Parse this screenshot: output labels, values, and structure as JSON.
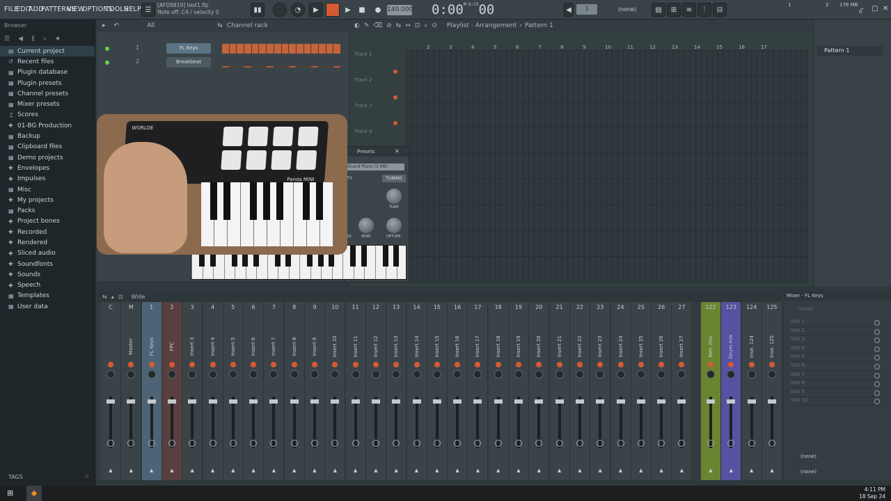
{
  "menu": [
    "FILE",
    "EDIT",
    "ADD",
    "PATTERNS",
    "VIEW",
    "OPTIONS",
    "TOOLS",
    "HELP"
  ],
  "hint": {
    "line1": "[AFD9819] test1.flp",
    "line2": "Note off: C4 / velocity 0"
  },
  "transport": {
    "bpm": "140.000",
    "time": "0:00",
    "time_sub": "00",
    "time_unit": "M:S:CS",
    "pattern_number": "1",
    "pattern_none": "(none)"
  },
  "cpu": {
    "value1": "1",
    "value2": "2",
    "mem": "178 MB",
    "poly": "0"
  },
  "browser": {
    "title": "Browser",
    "filter": "All",
    "items": [
      "Current project",
      "Recent files",
      "Plugin database",
      "Plugin presets",
      "Channel presets",
      "Mixer presets",
      "Scores",
      "01-BG Production",
      "Backup",
      "Clipboard files",
      "Demo projects",
      "Envelopes",
      "Impulses",
      "Misc",
      "My projects",
      "Packs",
      "Project bones",
      "Recorded",
      "Rendered",
      "Sliced audio",
      "Soundfonts",
      "Sounds",
      "Speech",
      "Templates",
      "User data"
    ],
    "tags_label": "TAGS"
  },
  "channel_rack": {
    "title": "Channel rack",
    "filter": "All",
    "channels": [
      {
        "num": "1",
        "name": "FL Keys"
      },
      {
        "num": "2",
        "name": "Breakbeat"
      }
    ]
  },
  "playlist": {
    "title": "Playlist - Arrangement",
    "pattern": "Pattern 1",
    "ruler": [
      "2",
      "3",
      "4",
      "5",
      "6",
      "7",
      "8",
      "9",
      "10",
      "11",
      "12",
      "13",
      "14",
      "15",
      "16",
      "17"
    ],
    "tracks": [
      "Track 1",
      "Track 2",
      "Track 3",
      "Track 4"
    ]
  },
  "pattern_panel": {
    "item": "Pattern 1"
  },
  "plugin": {
    "title": "Presets",
    "preset": "Grand Piano (3 MB)",
    "tab1": "TY",
    "tab2": "TUNING",
    "knob_labels": [
      "TUNE",
      "SENS",
      "DETUNE",
      "ESS"
    ]
  },
  "video": {
    "brand": "WORLDE",
    "model": "Panda MINI"
  },
  "mixer": {
    "title": "Mixer - FL Keys",
    "mode": "Wide",
    "tracks": [
      {
        "num": "C",
        "label": ""
      },
      {
        "num": "M",
        "label": "Master"
      },
      {
        "num": "1",
        "label": "FL Keys"
      },
      {
        "num": "2",
        "label": "FPC"
      },
      {
        "num": "3",
        "label": "Insert 3"
      },
      {
        "num": "4",
        "label": "Insert 4"
      },
      {
        "num": "5",
        "label": "Insert 5"
      },
      {
        "num": "6",
        "label": "Insert 6"
      },
      {
        "num": "7",
        "label": "Insert 7"
      },
      {
        "num": "8",
        "label": "Insert 8"
      },
      {
        "num": "9",
        "label": "Insert 9"
      },
      {
        "num": "10",
        "label": "Insert 10"
      },
      {
        "num": "11",
        "label": "Insert 11"
      },
      {
        "num": "12",
        "label": "Insert 12"
      },
      {
        "num": "13",
        "label": "Insert 13"
      },
      {
        "num": "14",
        "label": "Insert 14"
      },
      {
        "num": "15",
        "label": "Insert 15"
      },
      {
        "num": "16",
        "label": "Insert 16"
      },
      {
        "num": "17",
        "label": "Insert 17"
      },
      {
        "num": "18",
        "label": "Insert 18"
      },
      {
        "num": "19",
        "label": "Insert 19"
      },
      {
        "num": "20",
        "label": "Insert 20"
      },
      {
        "num": "21",
        "label": "Insert 21"
      },
      {
        "num": "22",
        "label": "Insert 22"
      },
      {
        "num": "23",
        "label": "Insert 23"
      },
      {
        "num": "24",
        "label": "Insert 24"
      },
      {
        "num": "25",
        "label": "Insert 25"
      },
      {
        "num": "26",
        "label": "Insert 26"
      },
      {
        "num": "27",
        "label": "Insert 27"
      },
      {
        "num": "122",
        "label": "Met. mix"
      },
      {
        "num": "123",
        "label": "Drum mix"
      },
      {
        "num": "124",
        "label": "Inse. 124"
      },
      {
        "num": "125",
        "label": "Inse. 125"
      }
    ],
    "side": {
      "top": "(none)",
      "slots": [
        "Slot 1",
        "Slot 2",
        "Slot 3",
        "Slot 4",
        "Slot 5",
        "Slot 6",
        "Slot 7",
        "Slot 8",
        "Slot 9",
        "Slot 10"
      ],
      "out1": "(none)",
      "out2": "(none)"
    }
  },
  "taskbar": {
    "time": "4:11 PM",
    "date": "18 Sep 24"
  },
  "colors": {
    "accent": "#d65a34",
    "selected": "#4c6476",
    "green_track": "#6b8432",
    "purple_track": "#5651a0"
  }
}
